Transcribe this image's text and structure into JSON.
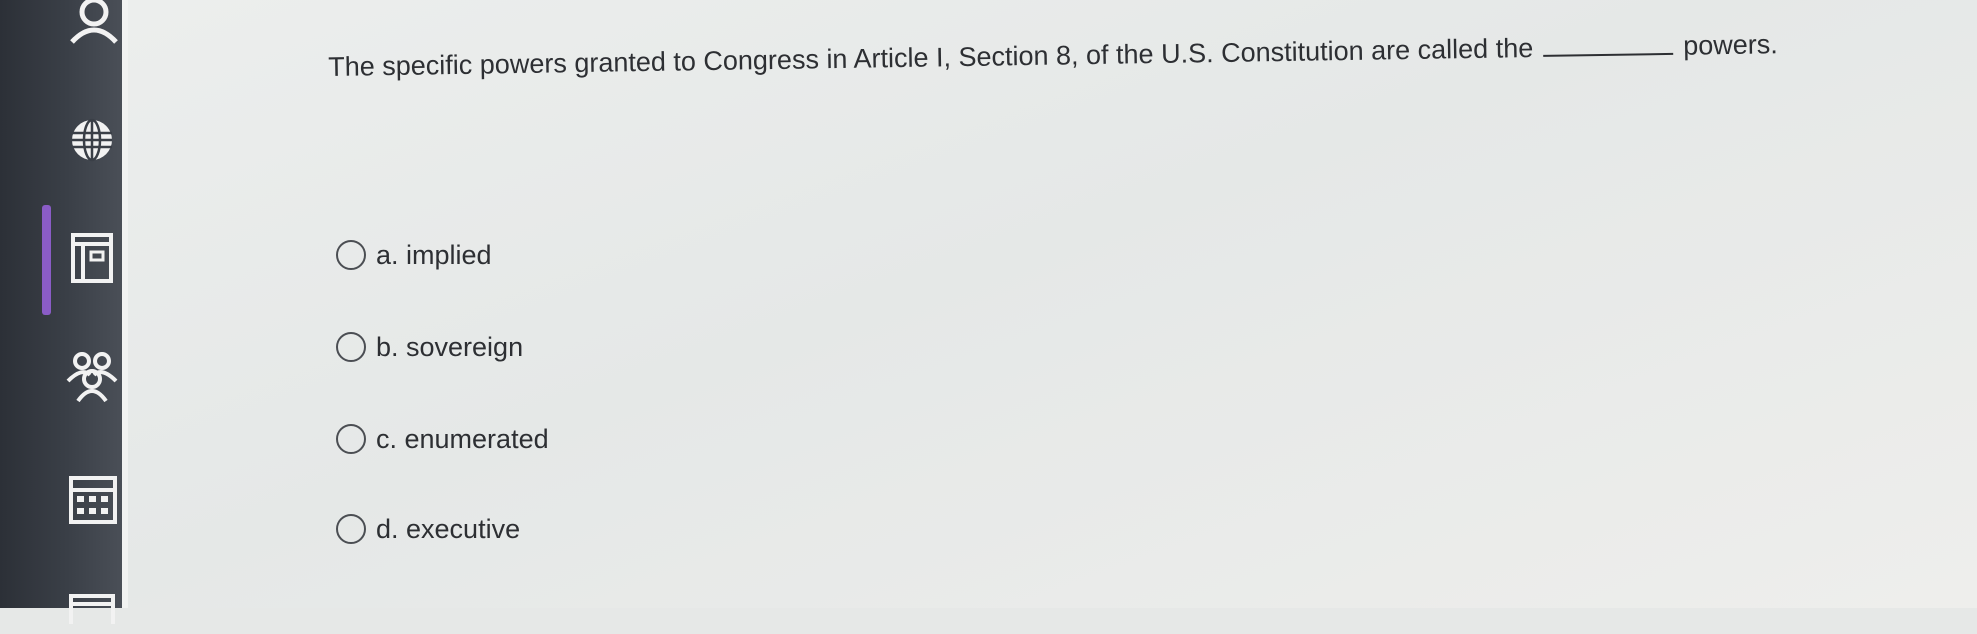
{
  "sidebar": {
    "icons": [
      "profile-icon",
      "globe-icon",
      "courses-icon",
      "groups-icon",
      "calendar-icon",
      "inbox-icon"
    ]
  },
  "question": {
    "prefix": "The specific powers granted to Congress in Article I, Section 8, of the U.S. Constitution are called the",
    "suffix": "powers."
  },
  "options": [
    {
      "label": "a. implied"
    },
    {
      "label": "b. sovereign"
    },
    {
      "label": "c. enumerated"
    },
    {
      "label": "d. executive"
    }
  ],
  "colors": {
    "sidebar_bg": "#33373e",
    "active_indicator": "#8a5cc6",
    "content_bg": "#e8eae9",
    "text": "#2d2f33"
  }
}
